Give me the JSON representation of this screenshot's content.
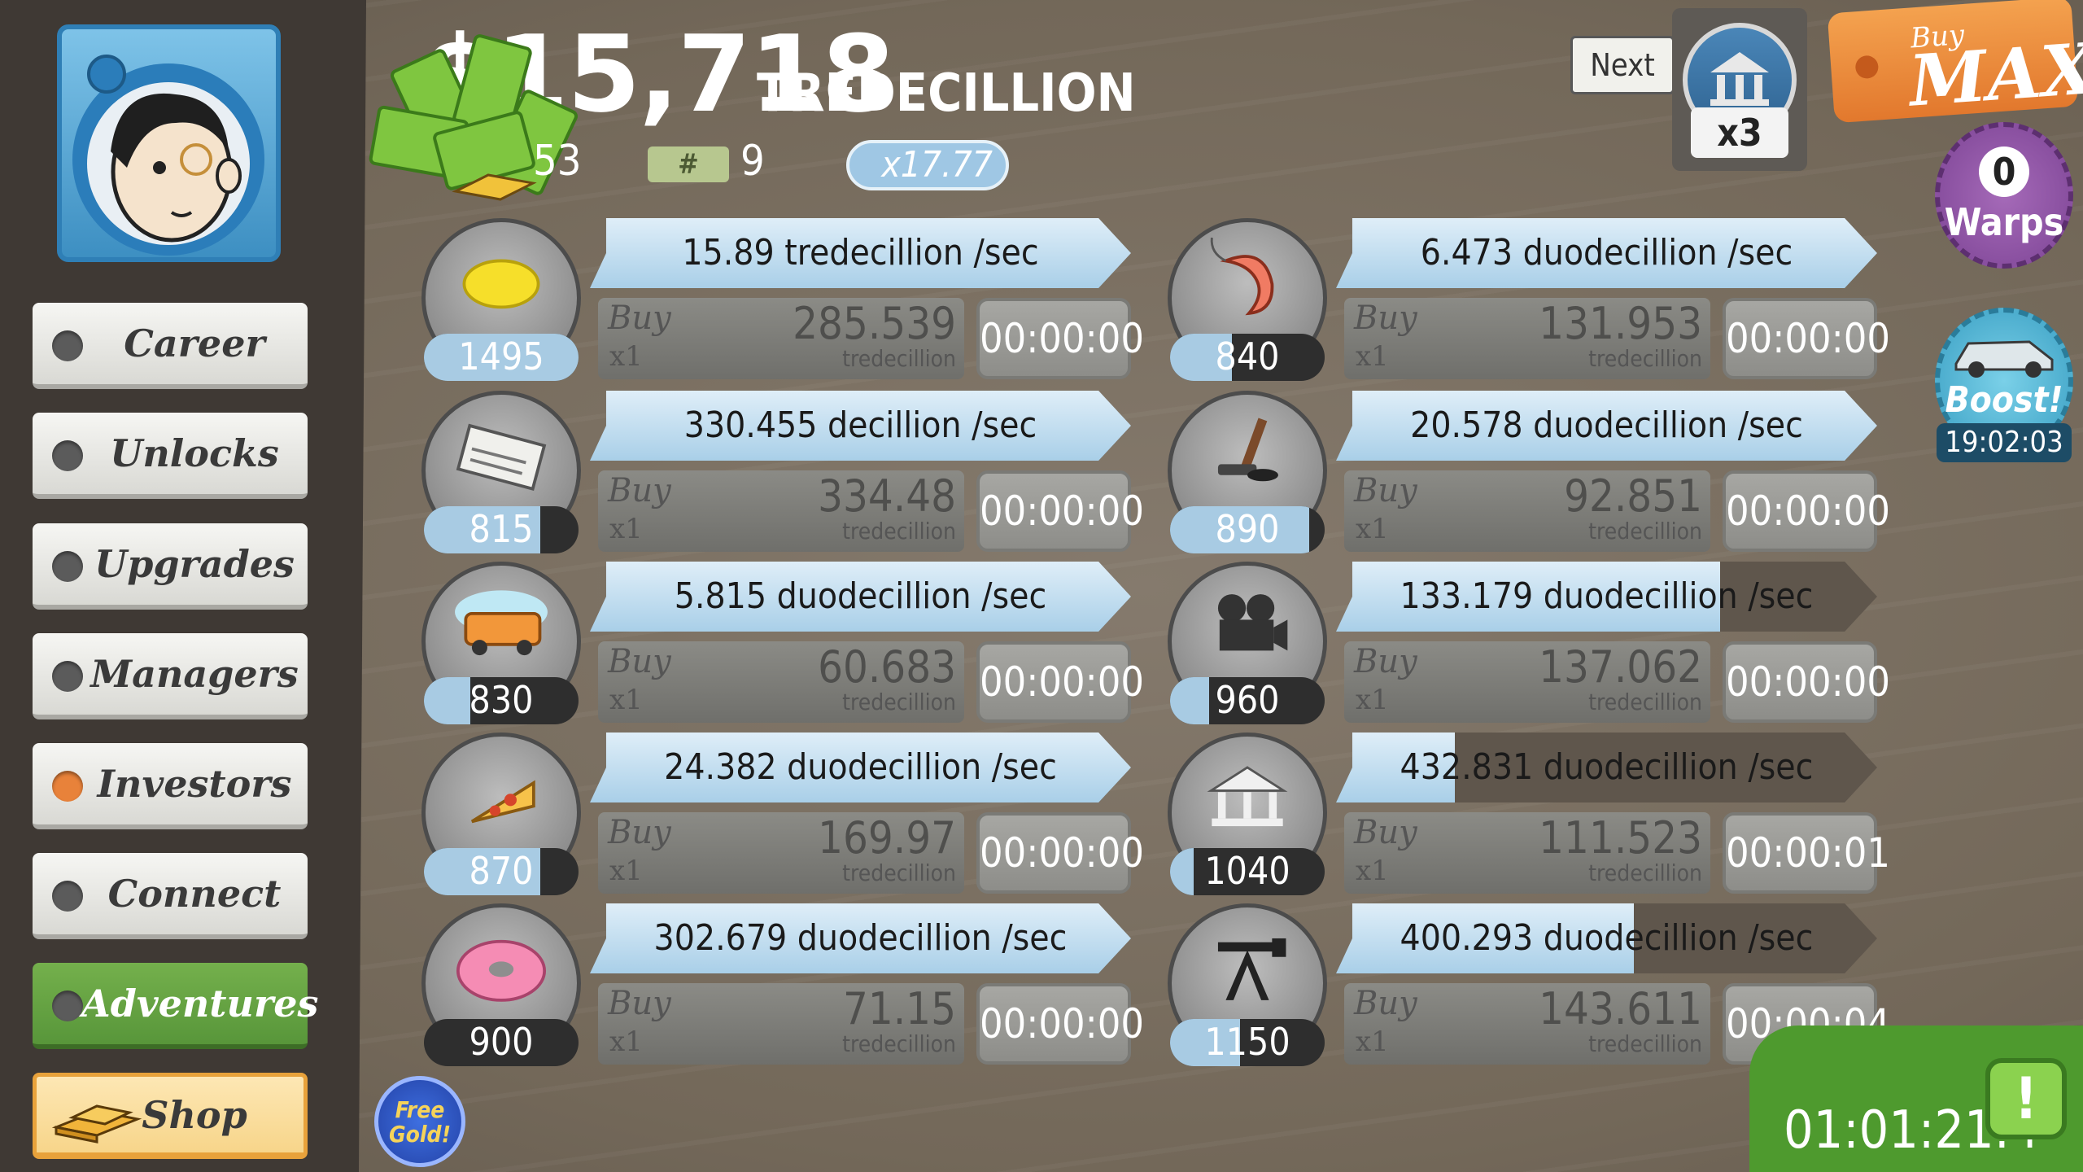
{
  "header": {
    "cash_amount": "$15,718",
    "cash_unit": "TREDECILLION",
    "gold_count": "53",
    "megabucks_label": "#",
    "megabucks_count": "9",
    "multiplier": "x17.77"
  },
  "next_unlock": {
    "next_label": "Next",
    "multiplier": "x3",
    "icon": "bank-icon"
  },
  "buy_max": {
    "line1": "Buy",
    "line2": "MAX"
  },
  "warps": {
    "count": "0",
    "label": "Warps"
  },
  "boost": {
    "label": "Boost!",
    "time": "19:02:03"
  },
  "sidebar": {
    "items": [
      {
        "label": "Career"
      },
      {
        "label": "Unlocks"
      },
      {
        "label": "Upgrades"
      },
      {
        "label": "Managers"
      },
      {
        "label": "Investors"
      },
      {
        "label": "Connect"
      },
      {
        "label": "Adventures"
      },
      {
        "label": "Shop"
      }
    ]
  },
  "businesses": [
    {
      "icon": "lemon-icon",
      "count": "1495",
      "count_fill": 1.0,
      "revenue": "15.89 tredecillion /sec",
      "revenue_fill": 1.0,
      "buy_label": "Buy",
      "buy_qty": "x1",
      "cost": "285.539",
      "cost_unit": "tredecillion",
      "timer": "00:00:00"
    },
    {
      "icon": "newspaper-icon",
      "count": "815",
      "count_fill": 0.75,
      "revenue": "330.455 decillion /sec",
      "revenue_fill": 1.0,
      "buy_label": "Buy",
      "buy_qty": "x1",
      "cost": "334.48",
      "cost_unit": "tredecillion",
      "timer": "00:00:00"
    },
    {
      "icon": "car-wash-icon",
      "count": "830",
      "count_fill": 0.3,
      "revenue": "5.815 duodecillion /sec",
      "revenue_fill": 1.0,
      "buy_label": "Buy",
      "buy_qty": "x1",
      "cost": "60.683",
      "cost_unit": "tredecillion",
      "timer": "00:00:00"
    },
    {
      "icon": "pizza-icon",
      "count": "870",
      "count_fill": 0.75,
      "revenue": "24.382 duodecillion /sec",
      "revenue_fill": 1.0,
      "buy_label": "Buy",
      "buy_qty": "x1",
      "cost": "169.97",
      "cost_unit": "tredecillion",
      "timer": "00:00:00"
    },
    {
      "icon": "donut-icon",
      "count": "900",
      "count_fill": 0.0,
      "revenue": "302.679 duodecillion /sec",
      "revenue_fill": 1.0,
      "buy_label": "Buy",
      "buy_qty": "x1",
      "cost": "71.15",
      "cost_unit": "tredecillion",
      "timer": "00:00:00"
    },
    {
      "icon": "shrimp-icon",
      "count": "840",
      "count_fill": 0.4,
      "revenue": "6.473 duodecillion /sec",
      "revenue_fill": 1.0,
      "buy_label": "Buy",
      "buy_qty": "x1",
      "cost": "131.953",
      "cost_unit": "tredecillion",
      "timer": "00:00:00"
    },
    {
      "icon": "hockey-icon",
      "count": "890",
      "count_fill": 0.9,
      "revenue": "20.578 duodecillion /sec",
      "revenue_fill": 1.0,
      "buy_label": "Buy",
      "buy_qty": "x1",
      "cost": "92.851",
      "cost_unit": "tredecillion",
      "timer": "00:00:00"
    },
    {
      "icon": "movie-camera-icon",
      "count": "960",
      "count_fill": 0.25,
      "revenue": "133.179 duodecillion /sec",
      "revenue_fill": 0.71,
      "buy_label": "Buy",
      "buy_qty": "x1",
      "cost": "137.062",
      "cost_unit": "tredecillion",
      "timer": "00:00:00"
    },
    {
      "icon": "bank-icon",
      "count": "1040",
      "count_fill": 0.15,
      "revenue": "432.831 duodecillion /sec",
      "revenue_fill": 0.22,
      "buy_label": "Buy",
      "buy_qty": "x1",
      "cost": "111.523",
      "cost_unit": "tredecillion",
      "timer": "00:00:01"
    },
    {
      "icon": "oil-rig-icon",
      "count": "1150",
      "count_fill": 0.45,
      "revenue": "400.293 duodecillion /sec",
      "revenue_fill": 0.55,
      "buy_label": "Buy",
      "buy_qty": "x1",
      "cost": "143.611",
      "cost_unit": "tredecillion",
      "timer": "00:00:04"
    }
  ],
  "free_gold": {
    "line1": "Free",
    "line2": "Gold!"
  },
  "event_timer": "01:01:21:4"
}
